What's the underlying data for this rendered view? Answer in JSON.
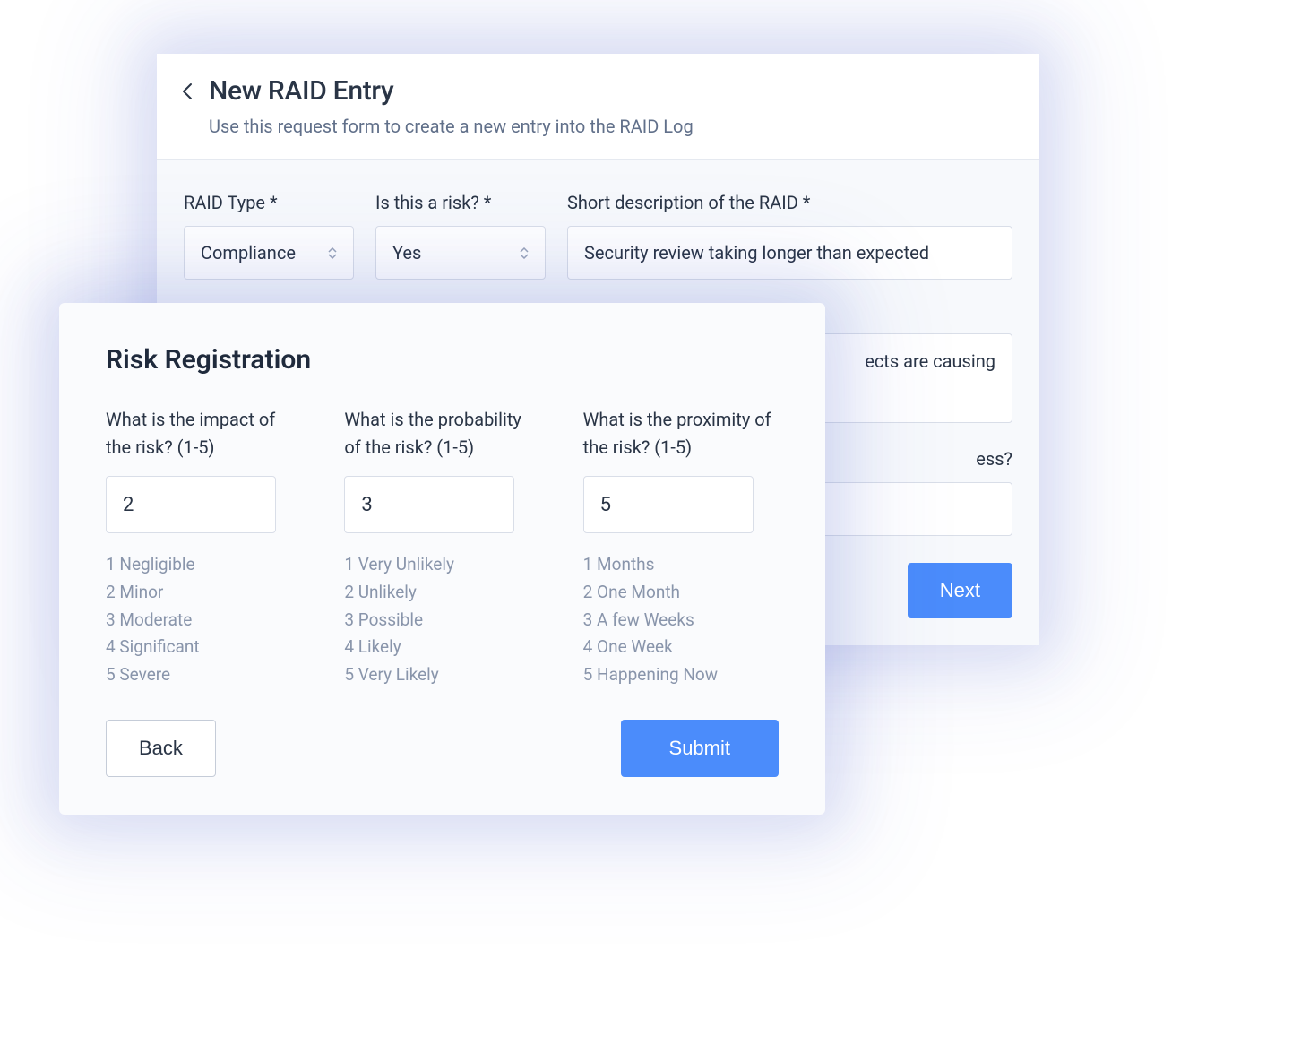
{
  "back_card": {
    "title": "New RAID Entry",
    "subtitle": "Use this request form to create a new entry into the RAID Log",
    "fields": {
      "raid_type": {
        "label": "RAID Type *",
        "value": "Compliance"
      },
      "is_risk": {
        "label": "Is this a risk? *",
        "value": "Yes"
      },
      "short_desc": {
        "label": "Short description of the RAID *",
        "value": "Security review taking longer than expected"
      },
      "partial_desc_fragment": "ects are causing",
      "partial_label_fragment": "ess?"
    },
    "next_button": "Next"
  },
  "front_card": {
    "title": "Risk Registration",
    "impact": {
      "label": "What is the impact of the risk? (1-5)",
      "value": "2",
      "scale": [
        "1 Negligible",
        "2 Minor",
        "3 Moderate",
        "4 Significant",
        "5 Severe"
      ]
    },
    "probability": {
      "label": "What is the probability of the risk? (1-5)",
      "value": "3",
      "scale": [
        "1 Very Unlikely",
        "2 Unlikely",
        "3 Possible",
        "4 Likely",
        "5 Very Likely"
      ]
    },
    "proximity": {
      "label": "What is the proximity of the risk? (1-5)",
      "value": "5",
      "scale": [
        "1 Months",
        "2 One Month",
        "3 A few Weeks",
        "4 One Week",
        "5 Happening Now"
      ]
    },
    "back_button": "Back",
    "submit_button": "Submit"
  }
}
